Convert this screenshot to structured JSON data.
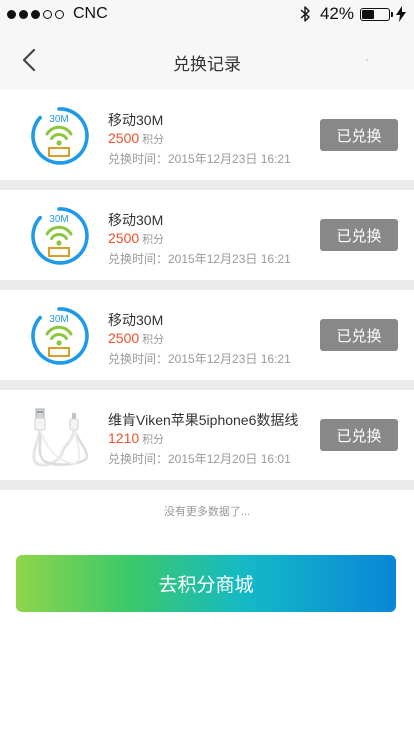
{
  "status_bar": {
    "carrier": "CNC",
    "battery_percent": "42%",
    "battery_level": 0.42
  },
  "nav": {
    "title": "兑换记录",
    "back_icon": "chevron-left-icon"
  },
  "records": [
    {
      "thumb_icon": "wifi-data-30m-icon",
      "thumb_label": "30M",
      "name": "移动30M",
      "points": "2500",
      "points_unit": "积分",
      "time": "兑换时间：2015年12月23日 16:21",
      "status": "已兑换"
    },
    {
      "thumb_icon": "wifi-data-30m-icon",
      "thumb_label": "30M",
      "name": "移动30M",
      "points": "2500",
      "points_unit": "积分",
      "time": "兑换时间：2015年12月23日 16:21",
      "status": "已兑换"
    },
    {
      "thumb_icon": "wifi-data-30m-icon",
      "thumb_label": "30M",
      "name": "移动30M",
      "points": "2500",
      "points_unit": "积分",
      "time": "兑换时间：2015年12月23日 16:21",
      "status": "已兑换"
    },
    {
      "thumb_icon": "usb-cable-icon",
      "name": "维肯Viken苹果5iphone6数据线",
      "points": "1210",
      "points_unit": "积分",
      "time": "兑换时间：2015年12月20日 16:01",
      "status": "已兑换"
    }
  ],
  "footer": {
    "no_more_text": "没有更多数据了...",
    "shop_button_label": "去积分商城"
  },
  "colors": {
    "points": "#f0512b",
    "redeemed_button": "#888888",
    "ring_blue": "#1e9ae8",
    "wifi_green": "#8cc63f"
  }
}
